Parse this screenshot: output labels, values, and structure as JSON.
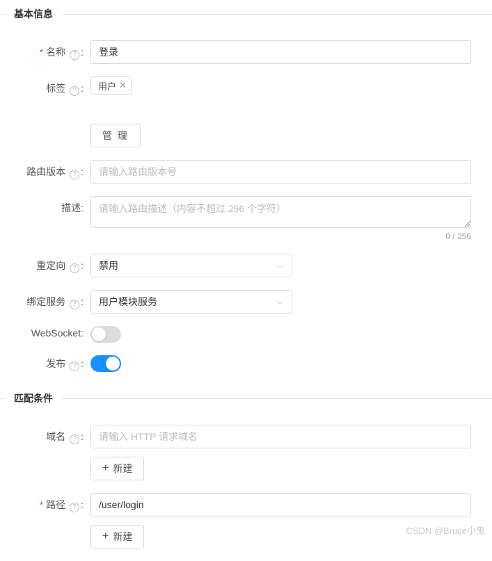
{
  "sections": {
    "basic": {
      "title": "基本信息"
    },
    "match": {
      "title": "匹配条件"
    }
  },
  "labels": {
    "name": "名称",
    "tags": "标签",
    "routeVersion": "路由版本",
    "description": "描述",
    "redirect": "重定向",
    "bindService": "绑定服务",
    "websocket": "WebSocket",
    "publish": "发布",
    "domain": "域名",
    "path": "路径",
    "colon": ":"
  },
  "values": {
    "name": "登录",
    "tagItem": "用户",
    "routeVersion": "",
    "description": "",
    "redirect": "禁用",
    "bindService": "用户模块服务",
    "domain": "",
    "path": "/user/login"
  },
  "placeholders": {
    "routeVersion": "请输入路由版本号",
    "description": "请输入路由描述（内容不超过 256 个字符）",
    "domain": "请输入 HTTP 请求域名"
  },
  "buttons": {
    "manage": "管 理",
    "create": "新建"
  },
  "charCount": "0 / 256",
  "watermark": "CSDN @Bruce小鬼"
}
